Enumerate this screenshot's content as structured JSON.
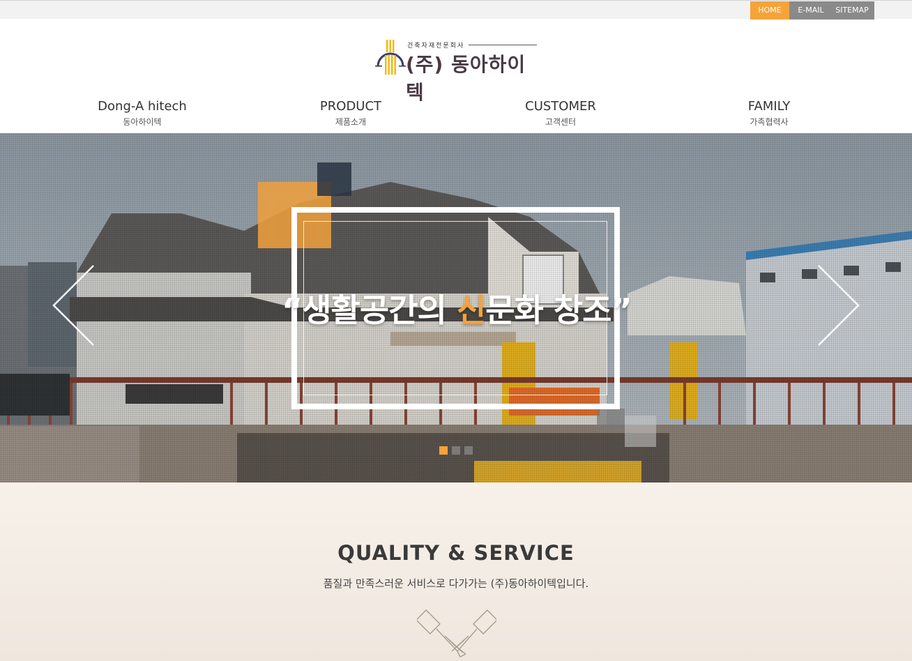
{
  "util": {
    "home": "HOME",
    "email": "E-MAIL",
    "sitemap": "SITEMAP"
  },
  "logo": {
    "tag": "건축자재전문회사",
    "name": "(주) 동아하이텍"
  },
  "nav": [
    {
      "en": "Dong-A hitech",
      "ko": "동아하이텍"
    },
    {
      "en": "PRODUCT",
      "ko": "제품소개"
    },
    {
      "en": "CUSTOMER",
      "ko": "고객센터"
    },
    {
      "en": "FAMILY",
      "ko": "가족협력사"
    }
  ],
  "hero": {
    "text_before": "“생활공간의 ",
    "text_highlight": "신",
    "text_after": "문화 창조”",
    "slides": 3,
    "active_slide": 1
  },
  "quality": {
    "title": "QUALITY & SERVICE",
    "subtitle": "품질과 만족스러운 서비스로 다가가는  (주)동아하이텍입니다."
  },
  "colors": {
    "accent": "#f6a33a",
    "util_gray": "#8a8a8a"
  }
}
